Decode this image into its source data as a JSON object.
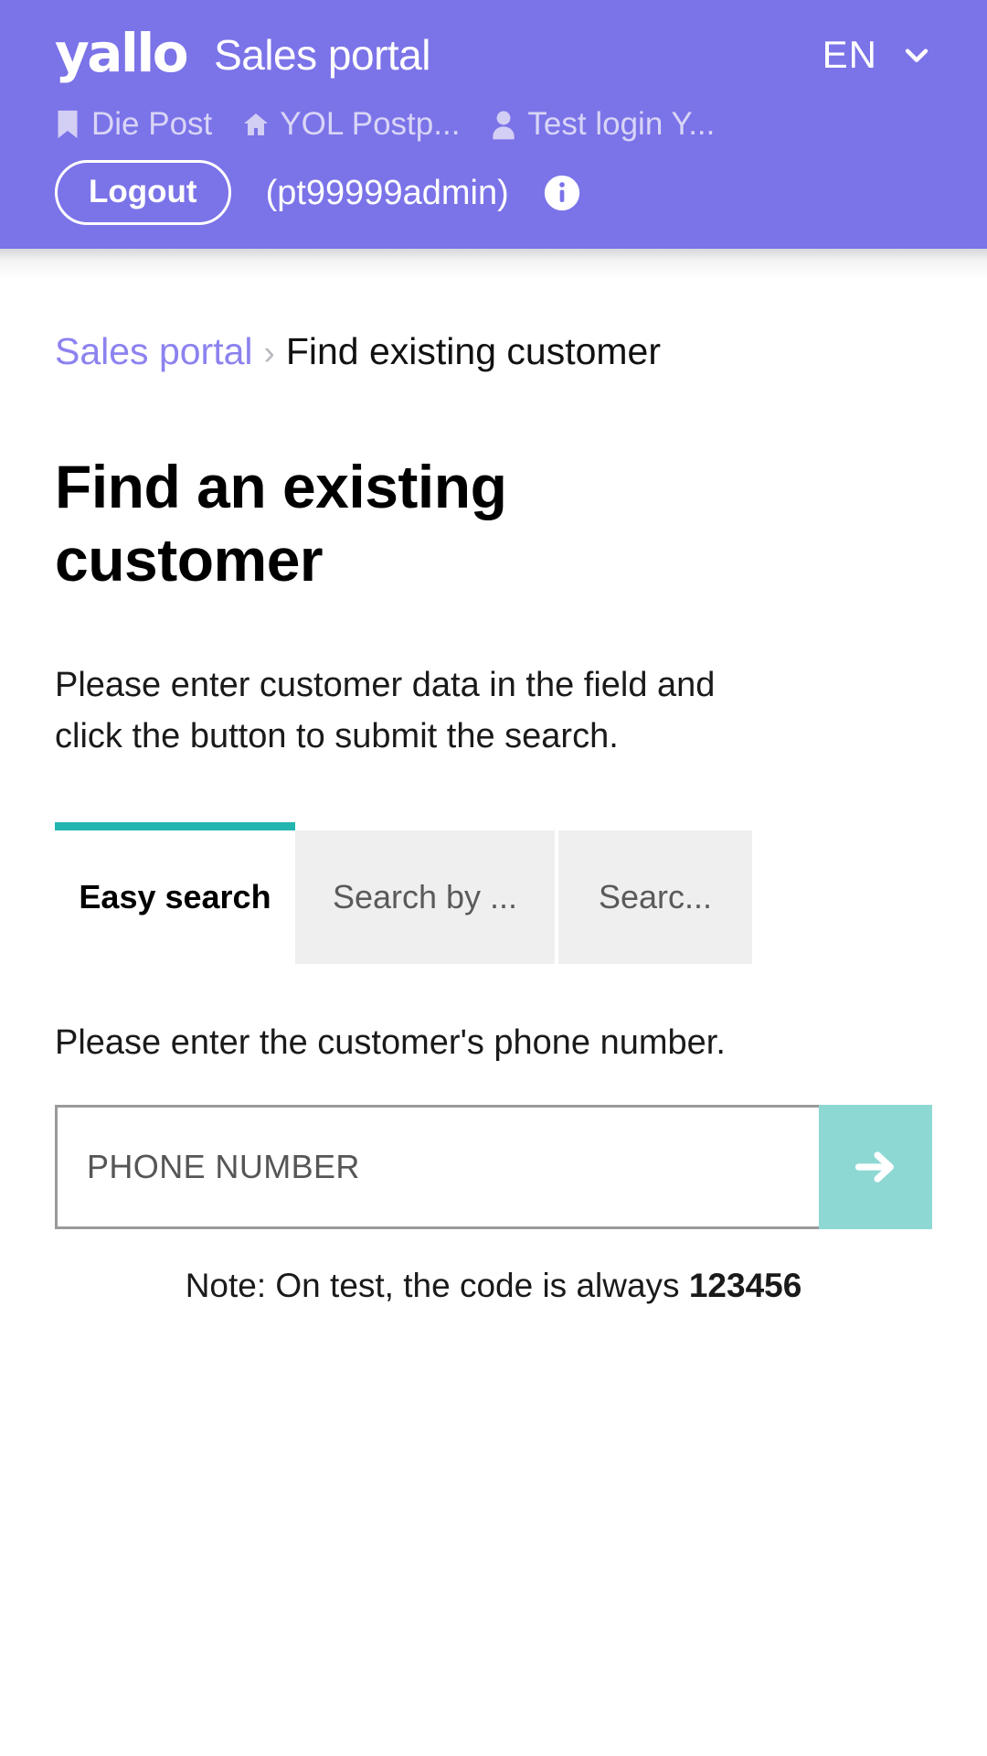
{
  "header": {
    "logo_text": "yallo",
    "portal_title": "Sales portal",
    "language": {
      "code": "EN",
      "chevron_icon": "chevron-down-icon"
    },
    "nav_items": [
      {
        "label": "Die Post",
        "icon": "bookmark-icon"
      },
      {
        "label": "YOL Postp...",
        "icon": "home-icon"
      },
      {
        "label": "Test login Y...",
        "icon": "user-icon"
      }
    ],
    "account": {
      "logout_label": "Logout",
      "username": "(pt99999admin)",
      "info_icon": "info-circle-icon"
    },
    "background_color": "#7b73e8"
  },
  "breadcrumb": {
    "parent": "Sales portal",
    "separator": "›",
    "current": "Find existing customer"
  },
  "main": {
    "page_title": "Find an existing customer",
    "intro": "Please enter customer data in the field and click the button to submit the search.",
    "tabs": [
      {
        "label": "Easy search",
        "active": true
      },
      {
        "label": "Search by ...",
        "active": false
      },
      {
        "label": "Searc...",
        "active": false
      }
    ],
    "active_tab_accent": "#23b5b0",
    "search_form": {
      "field_label": "Please enter the customer's phone number.",
      "phone_value": "",
      "phone_placeholder": "PHONE NUMBER",
      "submit_icon": "arrow-right-icon",
      "submit_color": "#8ed8d4"
    },
    "note_prefix": "Note: On test, the code is always ",
    "note_code": "123456"
  }
}
